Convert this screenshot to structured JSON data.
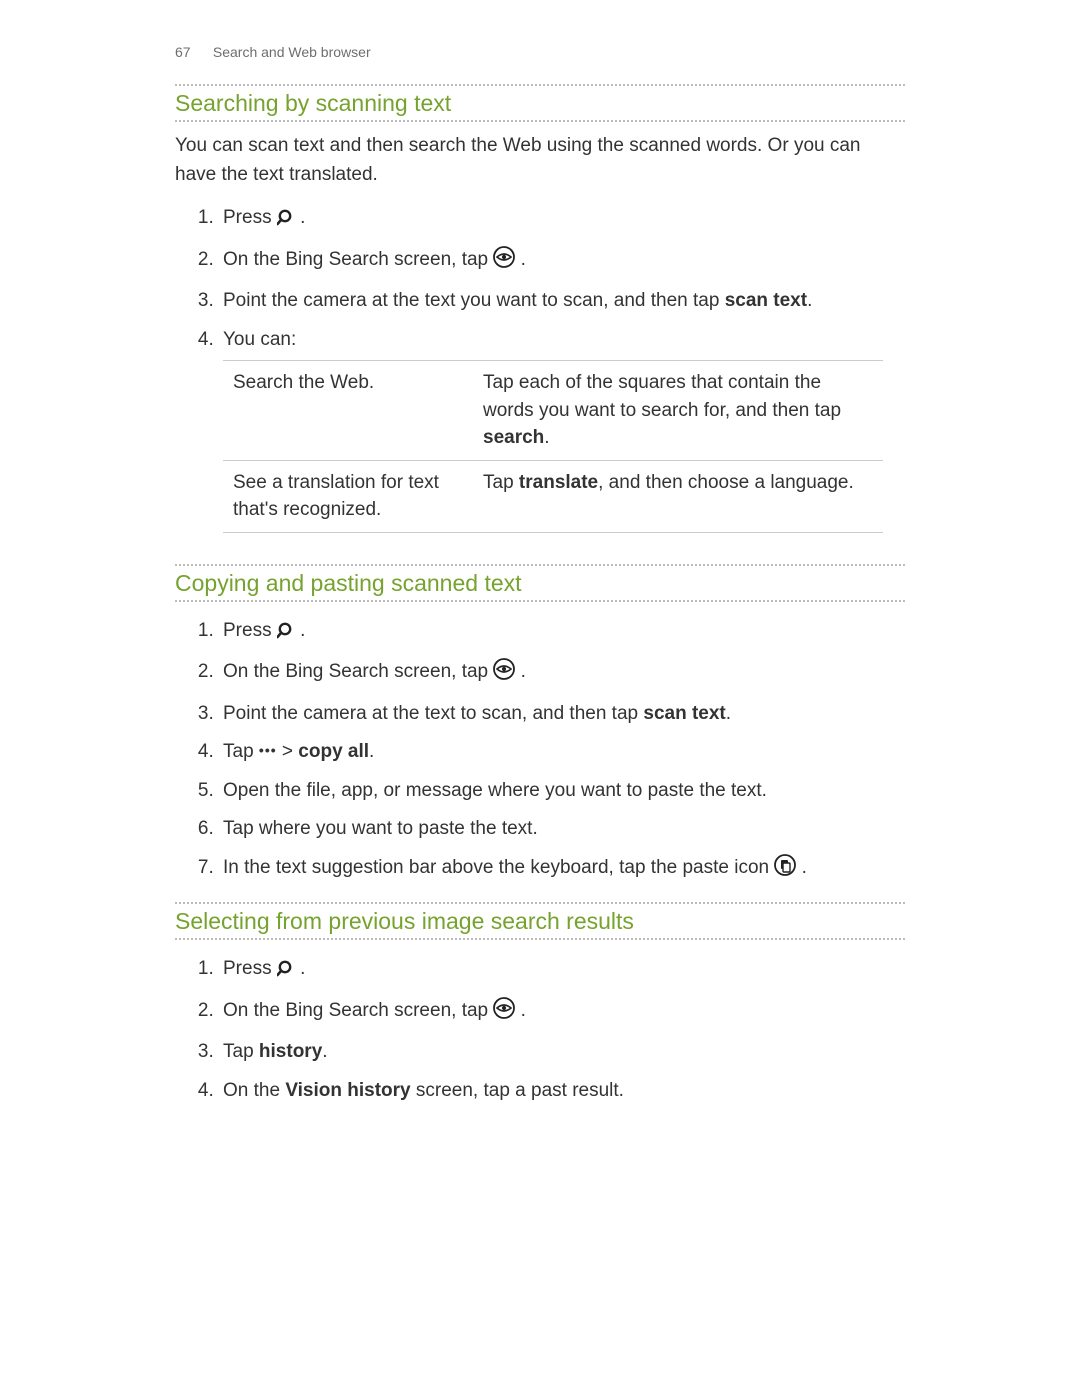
{
  "header": {
    "page_number": "67",
    "section": "Search and Web browser"
  },
  "sec1": {
    "title": "Searching by scanning text",
    "intro": "You can scan text and then search the Web using the scanned words. Or you can have the text translated.",
    "step1_a": "Press ",
    "step1_b": " .",
    "step2_a": "On the Bing Search screen, tap ",
    "step2_b": ".",
    "step3_a": "Point the camera at the text you want to scan, and then tap ",
    "step3_bold": "scan text",
    "step3_b": ".",
    "step4": "You can:",
    "table": {
      "r1c1": "Search the Web.",
      "r1c2_a": "Tap each of the squares that contain the words you want to search for, and then tap ",
      "r1c2_bold": "search",
      "r1c2_b": ".",
      "r2c1": "See a translation for text that's recognized.",
      "r2c2_a": "Tap ",
      "r2c2_bold": "translate",
      "r2c2_b": ", and then choose a language."
    }
  },
  "sec2": {
    "title": "Copying and pasting scanned text",
    "step1_a": "Press ",
    "step1_b": " .",
    "step2_a": "On the Bing Search screen, tap ",
    "step2_b": ".",
    "step3_a": "Point the camera at the text to scan, and then tap ",
    "step3_bold": "scan text",
    "step3_b": ".",
    "step4_a": "Tap ",
    "step4_more": "•••",
    "step4_gt": " > ",
    "step4_bold": "copy all",
    "step4_b": ".",
    "step5": "Open the file, app, or message where you want to paste the text.",
    "step6": "Tap where you want to paste the text.",
    "step7_a": "In the text suggestion bar above the keyboard, tap the paste icon ",
    "step7_b": "."
  },
  "sec3": {
    "title": "Selecting from previous image search results",
    "step1_a": "Press ",
    "step1_b": " .",
    "step2_a": "On the Bing Search screen, tap ",
    "step2_b": ".",
    "step3_a": "Tap ",
    "step3_bold": "history",
    "step3_b": ".",
    "step4_a": "On the ",
    "step4_bold": "Vision history",
    "step4_b": " screen, tap a past result."
  },
  "icons": {
    "search": "search-icon",
    "eye": "eye-circle-icon",
    "paste": "paste-circle-icon"
  }
}
